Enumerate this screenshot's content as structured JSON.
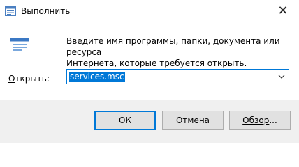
{
  "window": {
    "title": "Выполнить"
  },
  "description": {
    "line1": "Введите имя программы, папки, документа или ресурса",
    "line2": "Интернета, которые требуется открыть."
  },
  "open_field": {
    "label_prefix": "О",
    "label_rest": "ткрыть:",
    "value": "services.msc"
  },
  "buttons": {
    "ok": "ОК",
    "cancel": "Отмена",
    "browse_prefix": "Обзор",
    "browse_suffix": "..."
  },
  "colors": {
    "accent": "#0078d7",
    "footer_bg": "#f0f0f0",
    "button_bg": "#e1e1e1"
  },
  "icons": {
    "app": "run-dialog-icon",
    "close": "close-icon",
    "dropdown": "chevron-down-icon"
  }
}
